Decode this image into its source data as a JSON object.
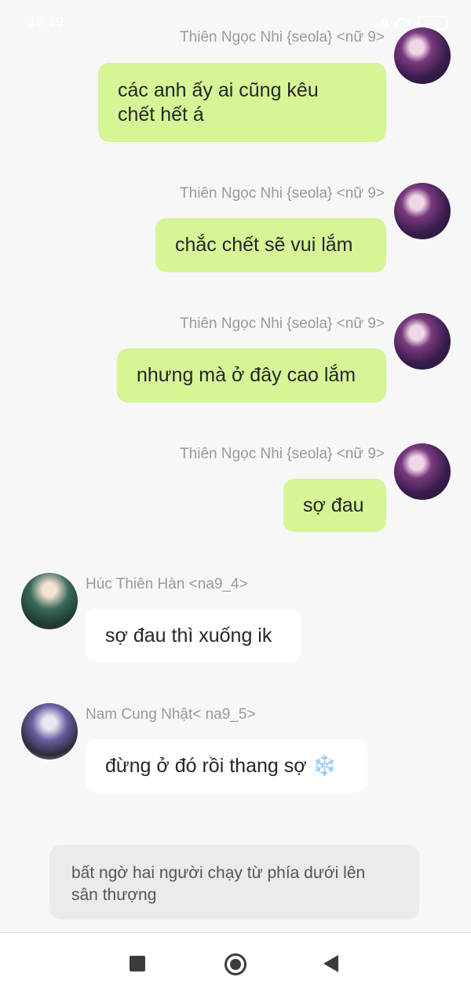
{
  "status_bar": {
    "time": "18:19"
  },
  "messages": [
    {
      "sender": "Thiên Ngọc Nhi {seola} <nữ 9>",
      "text_lines": [
        "các anh ấy ai cũng kêu",
        "chết hết á"
      ],
      "avatar": "avatar-seola"
    },
    {
      "sender": "Thiên Ngọc Nhi {seola} <nữ 9>",
      "text": "chắc chết sẽ vui lắm",
      "avatar": "avatar-seola"
    },
    {
      "sender": "Thiên Ngọc Nhi {seola} <nữ 9>",
      "text": "nhưng mà ở đây cao lắm",
      "avatar": "avatar-seola"
    },
    {
      "sender": "Thiên Ngọc Nhi {seola} <nữ 9>",
      "text": "sợ đau",
      "avatar": "avatar-seola"
    },
    {
      "sender": "Húc Thiên Hàn <na9_4>",
      "text": "sợ đau thì xuống ik",
      "avatar": "avatar-na9-4"
    },
    {
      "sender": "Nam Cung Nhật< na9_5>",
      "text": "đừng ở đó rồi thang sợ ❄️",
      "avatar": "avatar-na9-5"
    }
  ],
  "narration": {
    "lines": [
      "bất ngờ hai người chạy từ phía dưới lên",
      "sân thượng"
    ]
  },
  "colors": {
    "background": "#f7f7f7",
    "outgoing_bubble": "#d5f597",
    "incoming_bubble": "#ffffff",
    "narration_bg": "#ebebeb",
    "sender_name": "#9a9a9a"
  },
  "nav_icons": [
    "square-icon",
    "home-circle-icon",
    "back-triangle-icon"
  ]
}
